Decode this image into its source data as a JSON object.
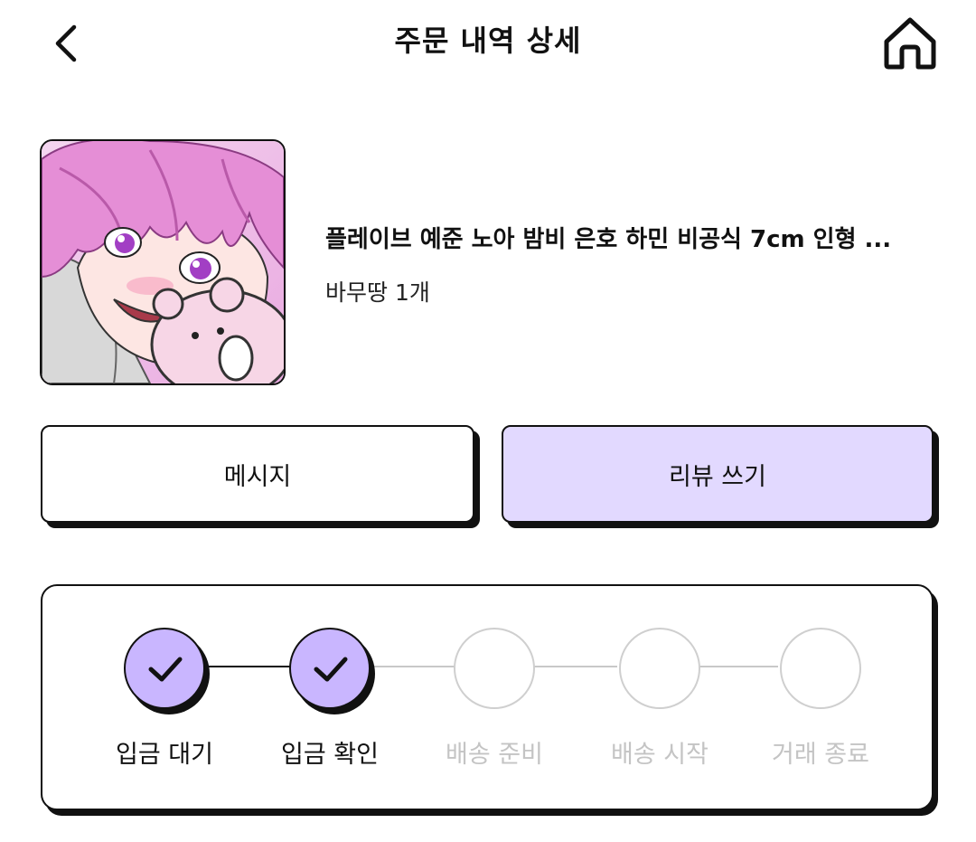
{
  "header": {
    "title": "주문 내역 상세",
    "back_icon": "chevron-left-icon",
    "home_icon": "home-icon"
  },
  "product": {
    "name": "플레이브 예준 노아 밤비 은호 하민 비공식 7cm 인형 ...",
    "option": "바무땅 1개",
    "thumbnail": "pink-haired-anime-boy-with-bear-plush-image"
  },
  "actions": {
    "message_label": "메시지",
    "review_label": "리뷰 쓰기"
  },
  "progress": {
    "steps": [
      {
        "label": "입금 대기",
        "done": true
      },
      {
        "label": "입금 확인",
        "done": true
      },
      {
        "label": "배송 준비",
        "done": false
      },
      {
        "label": "배송 시작",
        "done": false
      },
      {
        "label": "거래 종료",
        "done": false
      }
    ]
  },
  "colors": {
    "accent": "#c9b6ff",
    "review_button_bg": "#e2d9ff",
    "inactive": "#c4c4c4",
    "border": "#111111"
  }
}
